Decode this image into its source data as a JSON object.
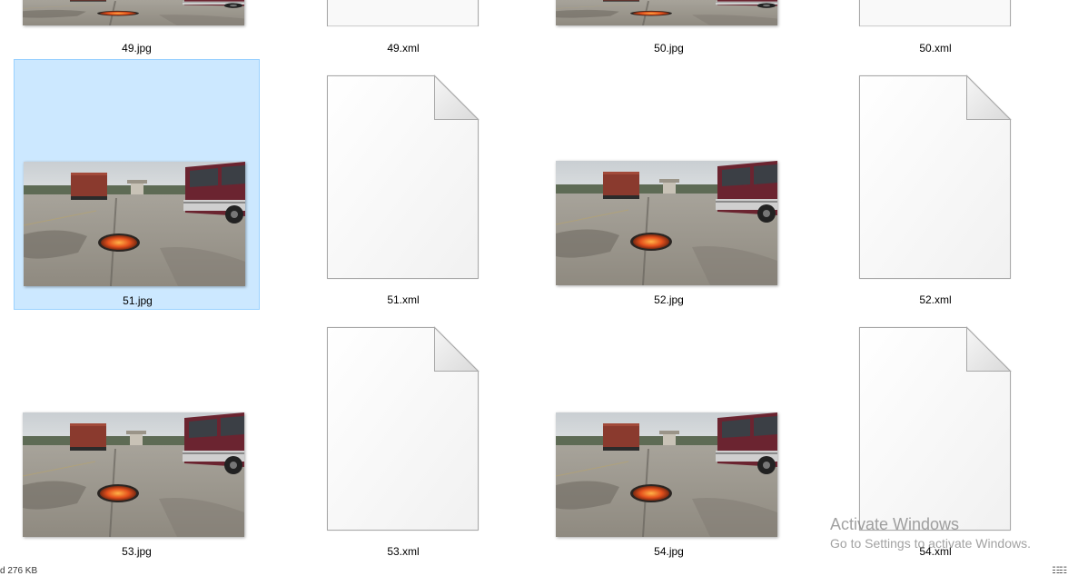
{
  "files": [
    {
      "name": "49.jpg",
      "type": "image"
    },
    {
      "name": "49.xml",
      "type": "document"
    },
    {
      "name": "50.jpg",
      "type": "image"
    },
    {
      "name": "50.xml",
      "type": "document"
    },
    {
      "name": "51.jpg",
      "type": "image",
      "selected": true
    },
    {
      "name": "51.xml",
      "type": "document"
    },
    {
      "name": "52.jpg",
      "type": "image"
    },
    {
      "name": "52.xml",
      "type": "document"
    },
    {
      "name": "53.jpg",
      "type": "image"
    },
    {
      "name": "53.xml",
      "type": "document"
    },
    {
      "name": "54.jpg",
      "type": "image"
    },
    {
      "name": "54.xml",
      "type": "document"
    }
  ],
  "watermark": {
    "title": "Activate Windows",
    "subtitle": "Go to Settings to activate Windows."
  },
  "status": {
    "text": "d  276 KB",
    "view_toggle_icon": "details-view-icon"
  },
  "colors": {
    "selection_bg": "#cce8ff",
    "selection_border": "#99d1ff"
  }
}
